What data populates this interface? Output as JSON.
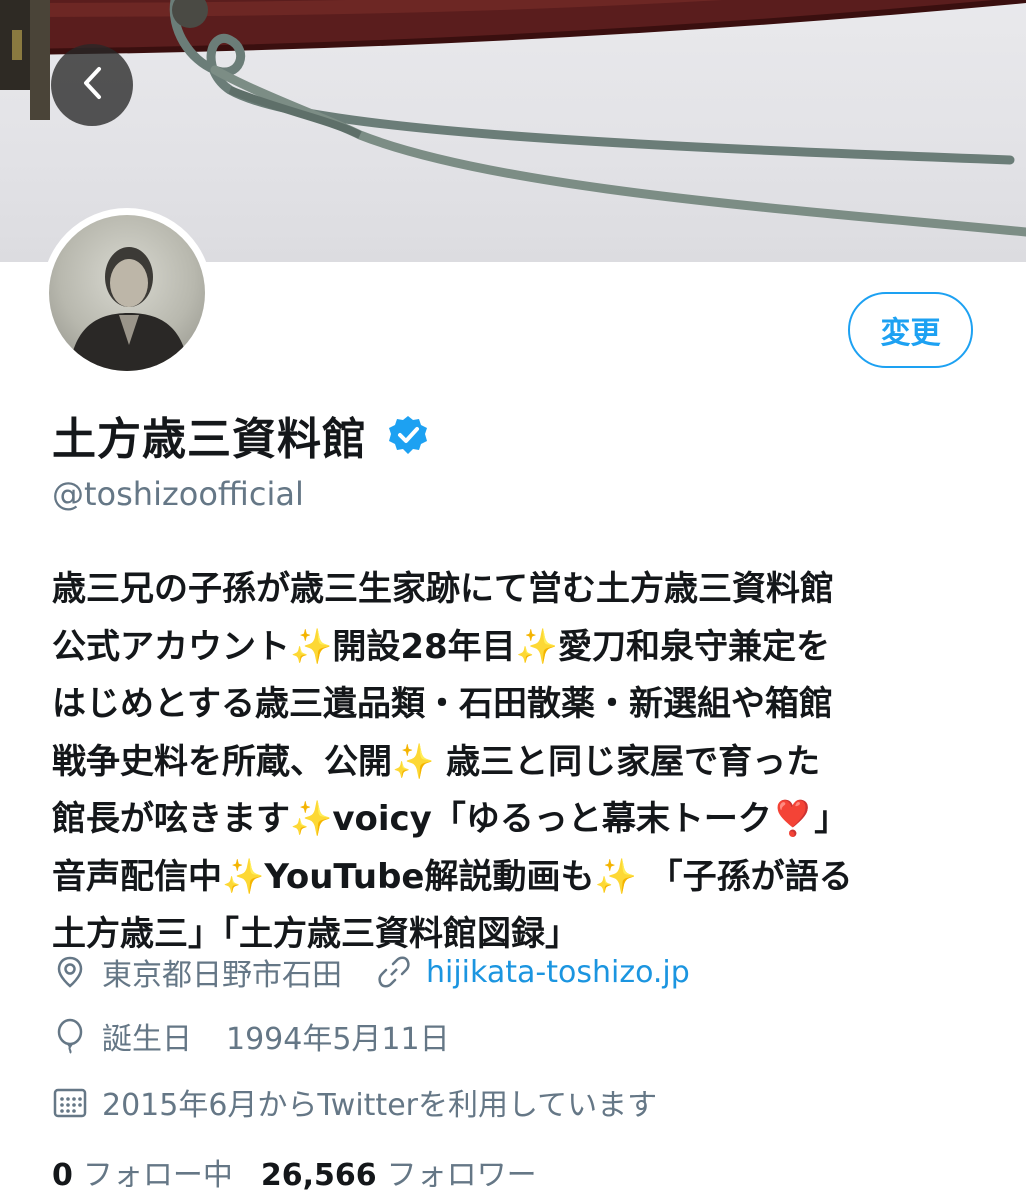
{
  "header": {
    "back_icon": "chevron-left-icon",
    "edit_button_label": "変更"
  },
  "profile": {
    "display_name": "土方歳三資料館",
    "verified_icon": "verified-badge-icon",
    "handle": "@toshizoofficial",
    "bio_lines": [
      [
        "歳三兄の子孫が歳三生家跡にて営む土方歳三資料館"
      ],
      [
        "公式アカウント",
        "✨",
        "開設28年目",
        "✨",
        "愛刀和泉守兼定を"
      ],
      [
        "はじめとする歳三遺品類・石田散薬・新選組や箱館"
      ],
      [
        "戦争史料を所蔵、公開",
        "✨",
        " 歳三と同じ家屋で育った"
      ],
      [
        "館長が呟きます",
        "✨",
        "voicy「ゆるっと幕末トーク",
        "❣️",
        "」"
      ],
      [
        "音声配信中",
        "✨",
        "YouTube解説動画も",
        "✨",
        " 「子孫が語る"
      ],
      [
        "土方歳三」「土方歳三資料館図録」"
      ]
    ],
    "location": "東京都日野市石田",
    "website": "hijikata-toshizo.jp",
    "birthday_label": "誕生日",
    "birthday": "1994年5月11日",
    "joined": "2015年6月からTwitterを利用しています"
  },
  "stats": {
    "following_count": "0",
    "following_label": "フォロー中",
    "followers_count": "26,566",
    "followers_label": "フォロワー"
  },
  "colors": {
    "accent": "#1da1f2",
    "link": "#1b95e0",
    "secondary_text": "#657786",
    "primary_text": "#14171a"
  }
}
